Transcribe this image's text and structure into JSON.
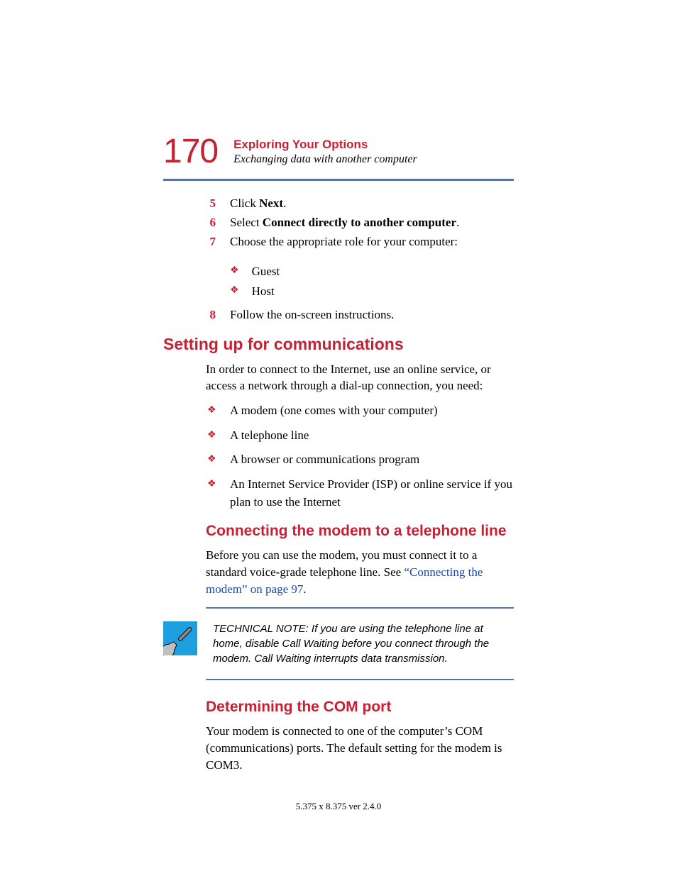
{
  "header": {
    "page_number": "170",
    "chapter": "Exploring Your Options",
    "section": "Exchanging data with another computer"
  },
  "steps": {
    "s5": {
      "num": "5",
      "pre": "Click ",
      "bold": "Next",
      "post": "."
    },
    "s6": {
      "num": "6",
      "pre": "Select ",
      "bold": "Connect directly to another computer",
      "post": "."
    },
    "s7": {
      "num": "7",
      "text": "Choose the appropriate role for your computer:"
    },
    "s7a": "Guest",
    "s7b": "Host",
    "s8": {
      "num": "8",
      "text": "Follow the on-screen instructions."
    }
  },
  "h2_setting": "Setting up for communications",
  "setting_intro": "In order to connect to the Internet, use an online service, or access a network through a dial-up connection, you need:",
  "setting_bullets": {
    "b1": "A modem (one comes with your computer)",
    "b2": "A telephone line",
    "b3": "A browser or communications program",
    "b4": "An Internet Service Provider (ISP) or online service if you plan to use the Internet"
  },
  "h3_connect": "Connecting the modem to a telephone line",
  "connect_para_pre": "Before you can use the modem, you must connect it to a standard voice-grade telephone line. See ",
  "connect_link": "“Connecting the modem” on page 97",
  "connect_para_post": ".",
  "tech_note": "TECHNICAL NOTE: If you are using the telephone line at home, disable Call Waiting before you connect through the modem. Call Waiting interrupts data transmission.",
  "h3_com": "Determining the COM port",
  "com_para": "Your modem is connected to one of the computer’s COM (communications) ports. The default setting for the modem is COM3.",
  "footer": "5.375 x 8.375 ver 2.4.0"
}
